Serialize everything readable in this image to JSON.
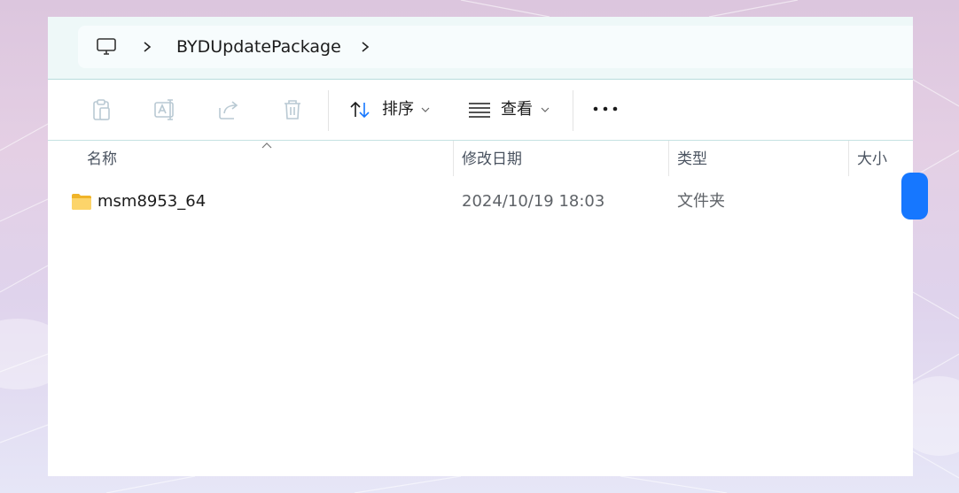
{
  "window": {
    "breadcrumb": {
      "root_icon": "computer-icon",
      "separator_icon": "chevron-right-icon",
      "folder": "BYDUpdatePackage"
    },
    "toolbar": {
      "icons": [
        "copy-icon",
        "rename-icon",
        "share-icon",
        "delete-icon"
      ],
      "sort_label": "排序",
      "view_label": "查看",
      "more_icon": "more-icon"
    },
    "columns": {
      "name": "名称",
      "modified": "修改日期",
      "type": "类型",
      "size": "大小"
    },
    "files": [
      {
        "name": "msm8953_64",
        "modified": "2024/10/19 18:03",
        "type": "文件夹",
        "size": "",
        "icon": "folder-icon"
      }
    ]
  },
  "colors": {
    "accent": "#1677ff",
    "folder": "#f6c34a",
    "muted_text": "#5f6368"
  }
}
